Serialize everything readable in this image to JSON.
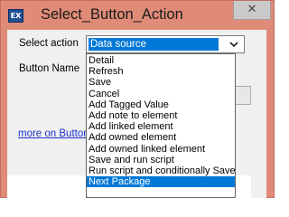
{
  "window": {
    "title": "Select_Button_Action",
    "icon_text": "EX",
    "close_glyph": "✕"
  },
  "form": {
    "select_action_label": "Select action",
    "button_name_label": "Button Name",
    "more_link": "more on Buttons"
  },
  "combo": {
    "selected": "Data source"
  },
  "dropdown": {
    "items": [
      {
        "label": "Detail",
        "selected": false
      },
      {
        "label": "Refresh",
        "selected": false
      },
      {
        "label": "Save",
        "selected": false
      },
      {
        "label": "Cancel",
        "selected": false
      },
      {
        "label": "Add Tagged Value",
        "selected": false
      },
      {
        "label": "Add note to element",
        "selected": false
      },
      {
        "label": "Add linked element",
        "selected": false
      },
      {
        "label": "Add owned element",
        "selected": false
      },
      {
        "label": "Add owned linked element",
        "selected": false
      },
      {
        "label": "Save and run script",
        "selected": false
      },
      {
        "label": "Run script and conditionally Save",
        "selected": false
      },
      {
        "label": "Next Package",
        "selected": true
      }
    ]
  },
  "colors": {
    "titlebar": "#e08b78",
    "selection": "#0078d7",
    "link": "#1a33cc"
  }
}
